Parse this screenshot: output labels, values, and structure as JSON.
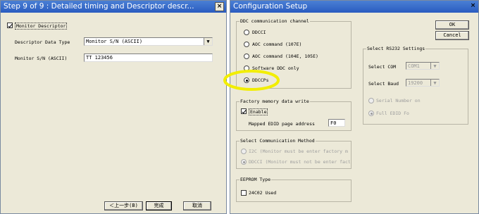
{
  "left_window": {
    "title": "Step 9 of 9 : Detailed timing and Descriptor descr...",
    "close_glyph": "×",
    "monitor_descriptor_checkbox": {
      "label": "Monitor Descriptor",
      "checked": true
    },
    "descriptor_type_label": "Descriptor Data Type",
    "descriptor_type_value": "Monitor S/N (ASCII)",
    "serial_label": "Monitor S/N (ASCII)",
    "serial_value": "TT 123456",
    "back_button": "＜上一步(B)",
    "finish_button": "完成",
    "cancel_button": "取消"
  },
  "right_window": {
    "title": "Configuration Setup",
    "close_glyph": "×",
    "ok_button": "OK",
    "cancel_button": "Cancel",
    "ddc_group": {
      "legend": "DDC communication channel",
      "options": [
        "DDCCI",
        "AOC command (107E)",
        "AOC command (104E, 105E)",
        "Software DDC only",
        "DDCCPs"
      ],
      "selected_index": 4
    },
    "rs232_group": {
      "legend": "Select RS232 Settings",
      "com_label": "Select COM",
      "com_value": "COM1",
      "baud_label": "Select Baud",
      "baud_value": "19200",
      "serial_number_option": "Serial Number on",
      "full_edid_option": "Full EDID Fo"
    },
    "factory_group": {
      "legend": "Factory memory data write",
      "enable_label": "Enable",
      "enable_checked": true,
      "address_label": "Mapped EDID page address",
      "address_value": "F0"
    },
    "comm_method_group": {
      "legend": "Select Communication Method",
      "option1": "I2C  (Monitor must be enter factory m",
      "option2": "DDCCI (Monitor must not be enter factor"
    },
    "eeprom_group": {
      "legend": "EEPROM Type",
      "option_label": "24C02 Used",
      "option_checked": false
    },
    "highlight_color": "#f2ee00"
  }
}
